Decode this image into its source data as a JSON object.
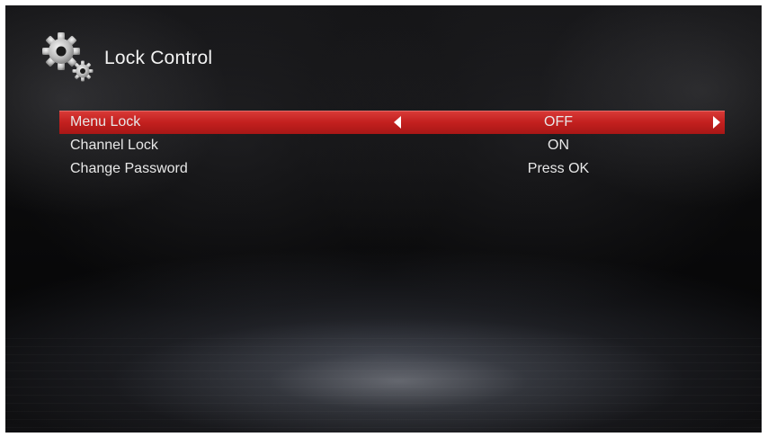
{
  "header": {
    "title": "Lock Control",
    "icon": "settings-gears-icon"
  },
  "menu": {
    "items": [
      {
        "label": "Menu Lock",
        "value": "OFF",
        "selected": true
      },
      {
        "label": "Channel Lock",
        "value": "ON",
        "selected": false
      },
      {
        "label": "Change Password",
        "value": "Press OK",
        "selected": false
      }
    ]
  },
  "colors": {
    "highlight": "#c8221f",
    "text": "#e8e8e8",
    "background": "#0b0b0c"
  }
}
